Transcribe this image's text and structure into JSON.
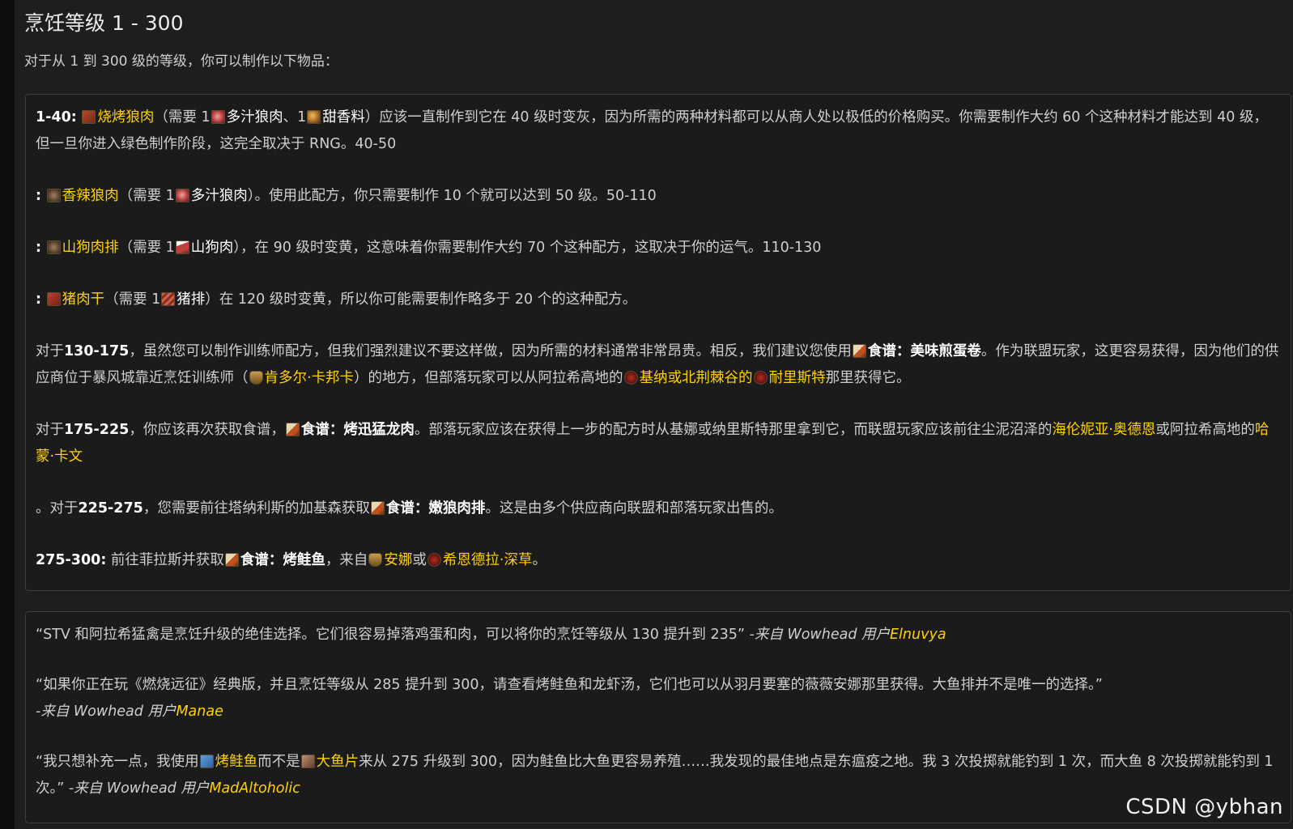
{
  "page": {
    "title": "烹饪等级 1 - 300",
    "intro": "对于从 1 到 300 级的等级，你可以制作以下物品："
  },
  "guide": {
    "p1": {
      "range": "1-40:",
      "recipe": "烧烤狼肉",
      "t1": "（需要 1",
      "mat1": "多汁狼肉",
      "t2": "、1",
      "mat2": "甜香料",
      "t3": "）应该一直制作到它在 40 级时变灰，因为所需的两种材料都可以从商人处以极低的价格购买。你需要制作大约 60 个这种材料才能达到 40 级，但一旦你进入绿色制作阶段，这完全取决于 RNG。40-50"
    },
    "p2": {
      "range": ":",
      "recipe": "香辣狼肉",
      "t1": "（需要 1",
      "mat1": "多汁狼肉",
      "t2": "）。使用此配方，你只需要制作 10 个就可以达到 50 级。50-110"
    },
    "p3": {
      "range": ":",
      "recipe": "山狗肉排",
      "t1": "（需要 1",
      "mat1": "山狗肉",
      "t2": "），在 90 级时变黄，这意味着你需要制作大约 70 个这种配方，这取决于你的运气。110-130"
    },
    "p4": {
      "range": ":",
      "recipe": "猪肉干",
      "t1": "（需要 1",
      "mat1": "猪排",
      "t2": "）在 120 级时变黄，所以你可能需要制作略多于 20 个的这种配方。"
    },
    "p5": {
      "t1": "对于",
      "range": "130-175",
      "t2": "，虽然您可以制作训练师配方，但我们强烈建议不要这样做，因为所需的材料通常非常昂贵。相反，我们建议您使用",
      "recipe": "食谱：美味煎蛋卷",
      "t3": "。作为联盟玩家，这更容易获得，因为他们的供应商位于暴风城靠近烹饪训练师（",
      "npc1": "肯多尔·卡邦卡",
      "t4": "）的地方，但部落玩家可以从阿拉希高地的",
      "npc2": "基纳或北荆棘谷的",
      "npc3": "耐里斯特",
      "t5": "那里获得它。"
    },
    "p6": {
      "t1": "对于",
      "range": "175-225",
      "t2": "，你应该再次获取食谱，",
      "recipe": "食谱：烤迅猛龙肉",
      "t3": "。部落玩家应该在获得上一步的配方时从基娜或纳里斯特那里拿到它，而联盟玩家应该前往尘泥沼泽的",
      "npc1": "海伦妮亚·奥德恩",
      "t4": "或阿拉希高地的",
      "npc2": "哈蒙·卡文"
    },
    "p7": {
      "t1": "。对于",
      "range": "225-275",
      "t2": "，您需要前往塔纳利斯的加基森获取",
      "recipe": "食谱：嫩狼肉排",
      "t3": "。这是由多个供应商向联盟和部落玩家出售的。"
    },
    "p8": {
      "range": "275-300:",
      "t1": "前往菲拉斯并获取",
      "recipe": "食谱：烤鲑鱼",
      "t2": "，来自",
      "npc1": "安娜",
      "t3": "或",
      "npc2": "希恩德拉·深草",
      "t4": "。"
    }
  },
  "quotes": {
    "q1": {
      "text": "“STV 和阿拉希猛禽是烹饪升级的绝佳选择。它们很容易掉落鸡蛋和肉，可以将你的烹饪等级从 130 提升到 235”",
      "attr": " -来自 Wowhead 用户",
      "user": "Elnuvya"
    },
    "q2": {
      "text": "“如果你正在玩《燃烧远征》经典版，并且烹饪等级从 285 提升到 300，请查看烤鲑鱼和龙虾汤，它们也可以从羽月要塞的薇薇安娜那里获得。大鱼排并不是唯一的选择。”",
      "attr": "-来自 Wowhead 用户",
      "user": "Manae"
    },
    "q3": {
      "t1": "“我只想补充一点，我使用",
      "item1": "烤鲑鱼",
      "t2": "而不是",
      "item2": "大鱼片",
      "t3": "来从 275 升级到 300，因为鲑鱼比大鱼更容易养殖……我发现的最佳地点是东瘟疫之地。我 3 次投掷就能钓到 1 次，而大鱼 8 次投掷就能钓到 1 次。”",
      "attr": " -来自 Wowhead 用户",
      "user": "MadAltoholic"
    }
  },
  "watermark": "CSDN @ybhan",
  "colors": {
    "link": "#ffd100",
    "background": "#1e1e1e",
    "border": "#3c3c3c"
  }
}
